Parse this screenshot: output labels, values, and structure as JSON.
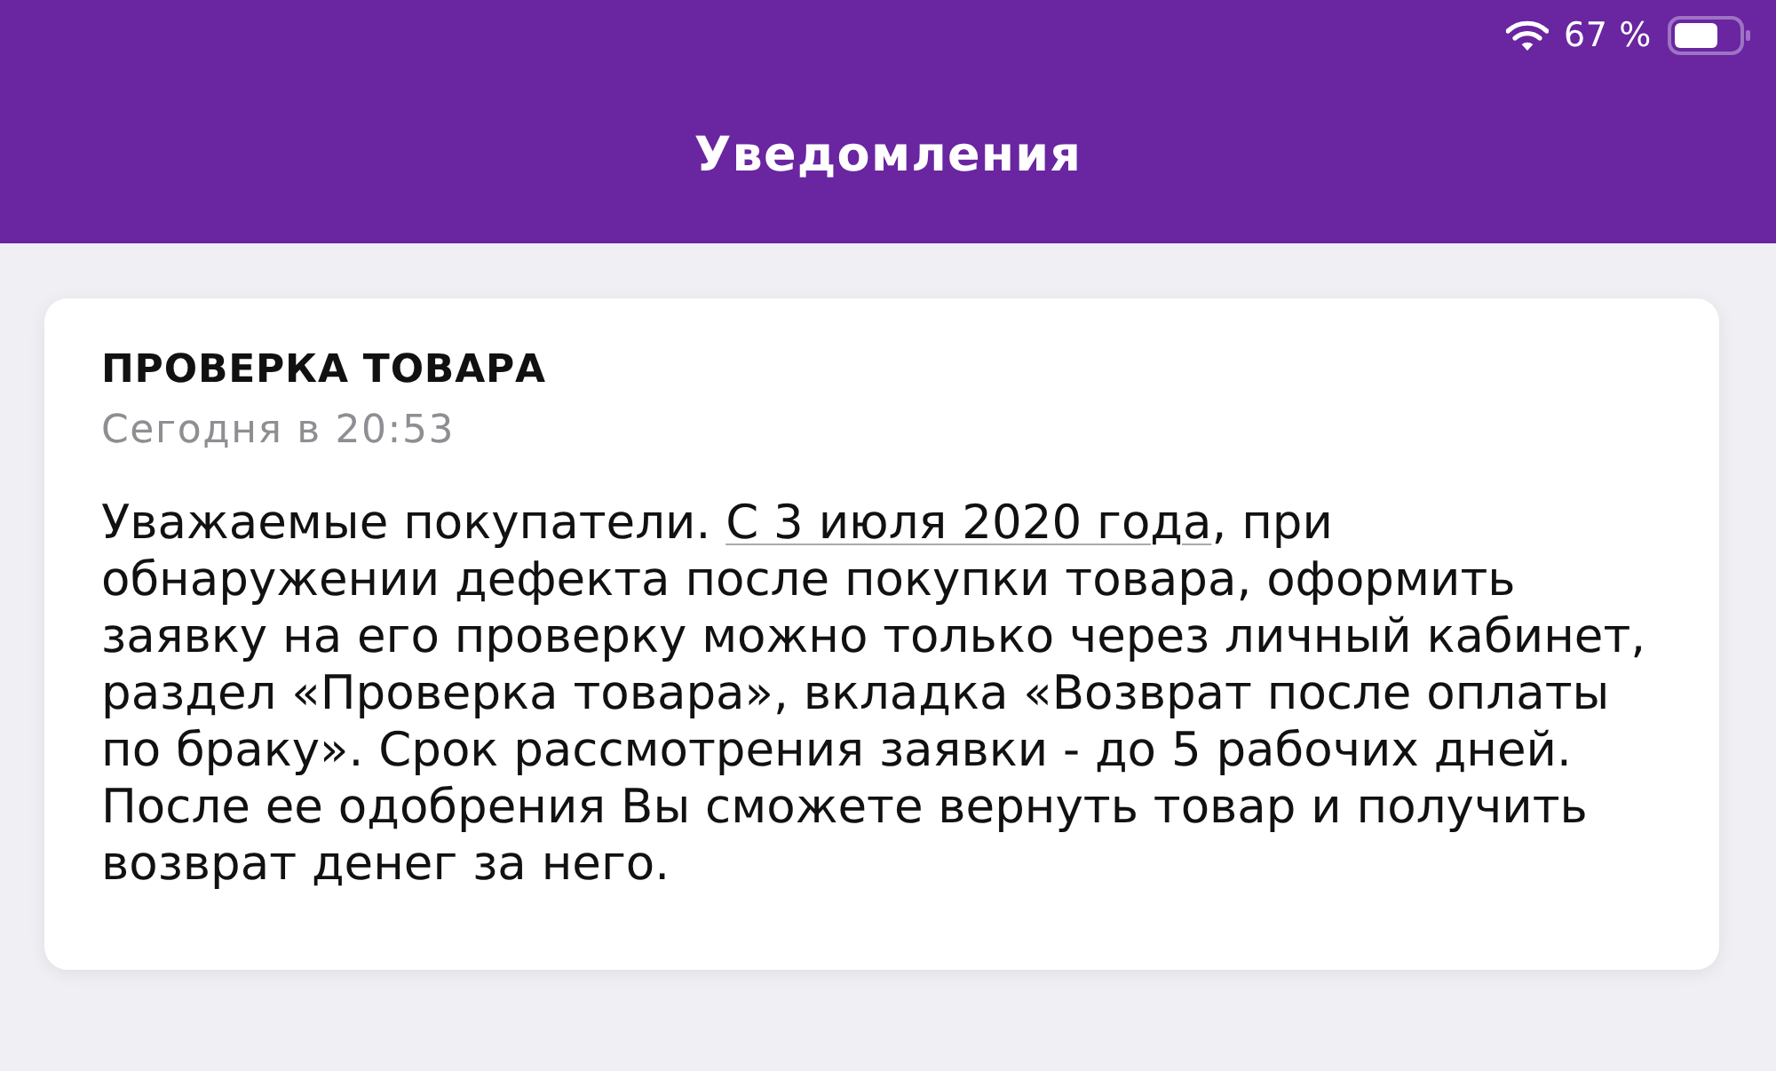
{
  "status_bar": {
    "battery_text": "67 %"
  },
  "header": {
    "title": "Уведомления"
  },
  "notifications": [
    {
      "title": "ПРОВЕРКА ТОВАРА",
      "time": "Сегодня в 20:53",
      "body": [
        {
          "kind": "text",
          "text": "Уважаемые покупатели. "
        },
        {
          "kind": "link",
          "text": "С 3 июля 2020 года"
        },
        {
          "kind": "text",
          "text": ", при обнаружении дефекта после покупки товара, оформить заявку на его проверку можно только через личный кабинет, раздел «Проверка товара», вкладка «Возврат после оплаты по браку». Срок рассмотрения заявки - до 5 рабочих дней. После ее одобрения Вы сможете вернуть товар и получить возврат денег за него."
        }
      ]
    }
  ]
}
